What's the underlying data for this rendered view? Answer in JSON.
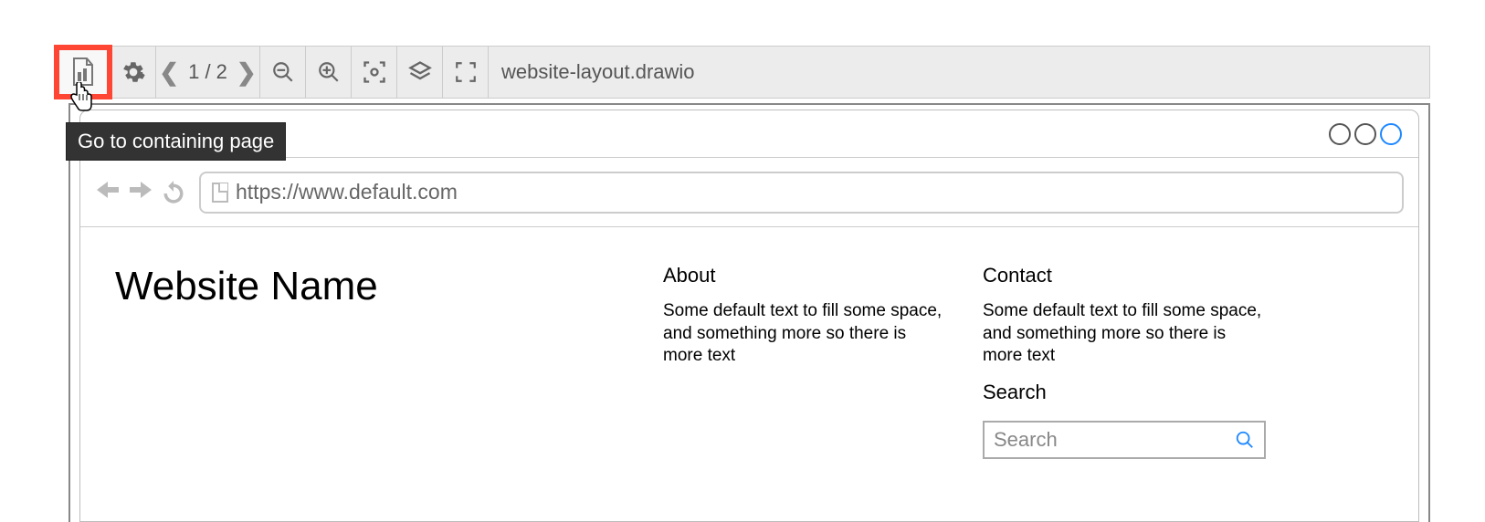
{
  "toolbar": {
    "page_current": 1,
    "page_total": 2,
    "page_display": "1 / 2",
    "filename": "website-layout.drawio"
  },
  "tooltip": "Go to containing page",
  "mockup": {
    "url": "https://www.default.com",
    "site_title": "Website Name",
    "about": {
      "heading": "About",
      "body": "Some default text to fill some space, and something more so there is more text"
    },
    "contact": {
      "heading": "Contact",
      "body": "Some default text to fill some space, and something more so there is more text"
    },
    "search": {
      "heading": "Search",
      "placeholder": "Search"
    }
  }
}
